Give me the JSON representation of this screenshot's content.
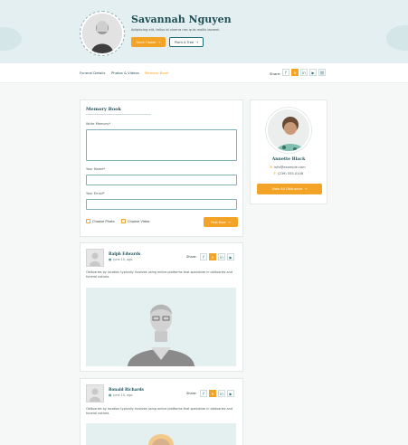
{
  "hero": {
    "name": "Savannah Nguyen",
    "subtitle": "Adipiscing elit, tellus id viverra nec quis mollis laoreet.",
    "send_flower": "Send Flower",
    "plant_tree": "Plant A Tree"
  },
  "nav": {
    "tabs": [
      "Funeral Details",
      "Photos & Videos",
      "Memory Book"
    ],
    "share_label": "Share:"
  },
  "memory_form": {
    "title": "Memory Book",
    "memory_label": "Write Memory*",
    "name_label": "Your Name*",
    "email_label": "Your Email*",
    "choose_photo": "Choose Photo",
    "choose_video": "Choose Video",
    "post_now": "Post Now"
  },
  "profile": {
    "name": "Annette Black",
    "email": "info@example.com",
    "phone": "(239) 555-0108",
    "view_obituaries": "View All Obituaries"
  },
  "posts": [
    {
      "name": "Ralph Edwards",
      "date": "June 10, ago",
      "share_label": "Share:",
      "text": "Obituaries by location typically involves using online platforms that specialize in obituaries and funeral notices."
    },
    {
      "name": "Ronald Richards",
      "date": "June 10, ago",
      "share_label": "Share:",
      "text": "Obituaries by location typically involves using online platforms that specialize in obituaries and funeral notices."
    }
  ],
  "colors": {
    "accent": "#f3a325",
    "primary": "#1f4f55",
    "hero_bg": "#e3eff0"
  },
  "icons": [
    "facebook-icon",
    "twitter-icon",
    "linkedin-icon",
    "youtube-icon",
    "link-icon",
    "calendar-icon",
    "mail-icon",
    "phone-icon",
    "arrow-right-icon"
  ]
}
